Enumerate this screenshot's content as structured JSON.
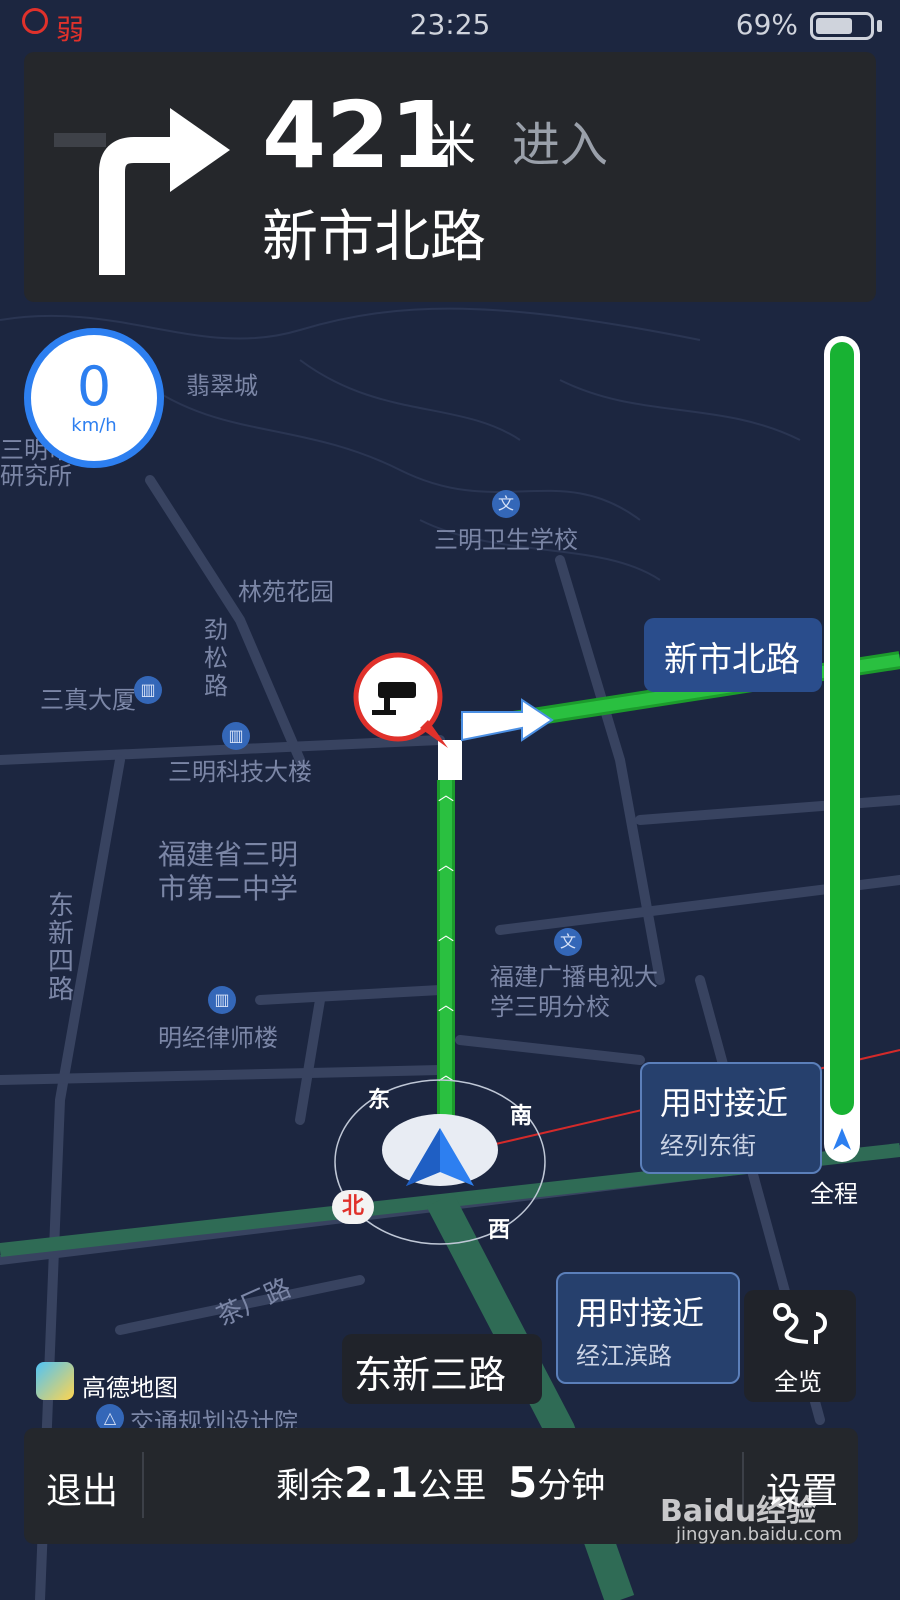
{
  "status": {
    "signal": "弱",
    "time": "23:25",
    "battery": "69%",
    "battery_level": 0.69
  },
  "guide": {
    "distance": "421",
    "unit": "米",
    "action": "进入",
    "road": "新市北路",
    "turn_icon": "turn-right-icon"
  },
  "speed": {
    "value": "0",
    "unit": "km/h"
  },
  "map": {
    "pois": [
      "翡翠城",
      "三明卫生学校",
      "林苑花园",
      "劲松路",
      "三真大厦",
      "三明科技大楼",
      "福建省三明市第二中学",
      "福建广播电视大学三明分校",
      "东新四路",
      "明经律师楼",
      "茶厂路",
      "交通规划设计院",
      "三明市",
      "研究所"
    ],
    "compass": {
      "n": "北",
      "e": "东",
      "s": "南",
      "w": "西"
    },
    "road_callout": "新市北路",
    "current_road": "东新三路"
  },
  "callouts": [
    {
      "title": "用时接近",
      "sub": "经列东街"
    },
    {
      "title": "用时接近",
      "sub": "经江滨路"
    }
  ],
  "progress": {
    "label": "全程",
    "fraction": 0.95
  },
  "overview": {
    "label": "全览"
  },
  "brand": "高德地图",
  "bottom": {
    "exit": "退出",
    "remaining_prefix": "剩余",
    "remaining_km": "2.1",
    "remaining_km_unit": "公里",
    "remaining_min": "5",
    "remaining_min_unit": "分钟",
    "settings": "设置"
  },
  "watermark": {
    "text": "Baidu经验",
    "url": "jingyan.baidu.com"
  },
  "colors": {
    "route": "#18b233",
    "accent": "#2d7ff0",
    "alert": "#e0312b"
  }
}
